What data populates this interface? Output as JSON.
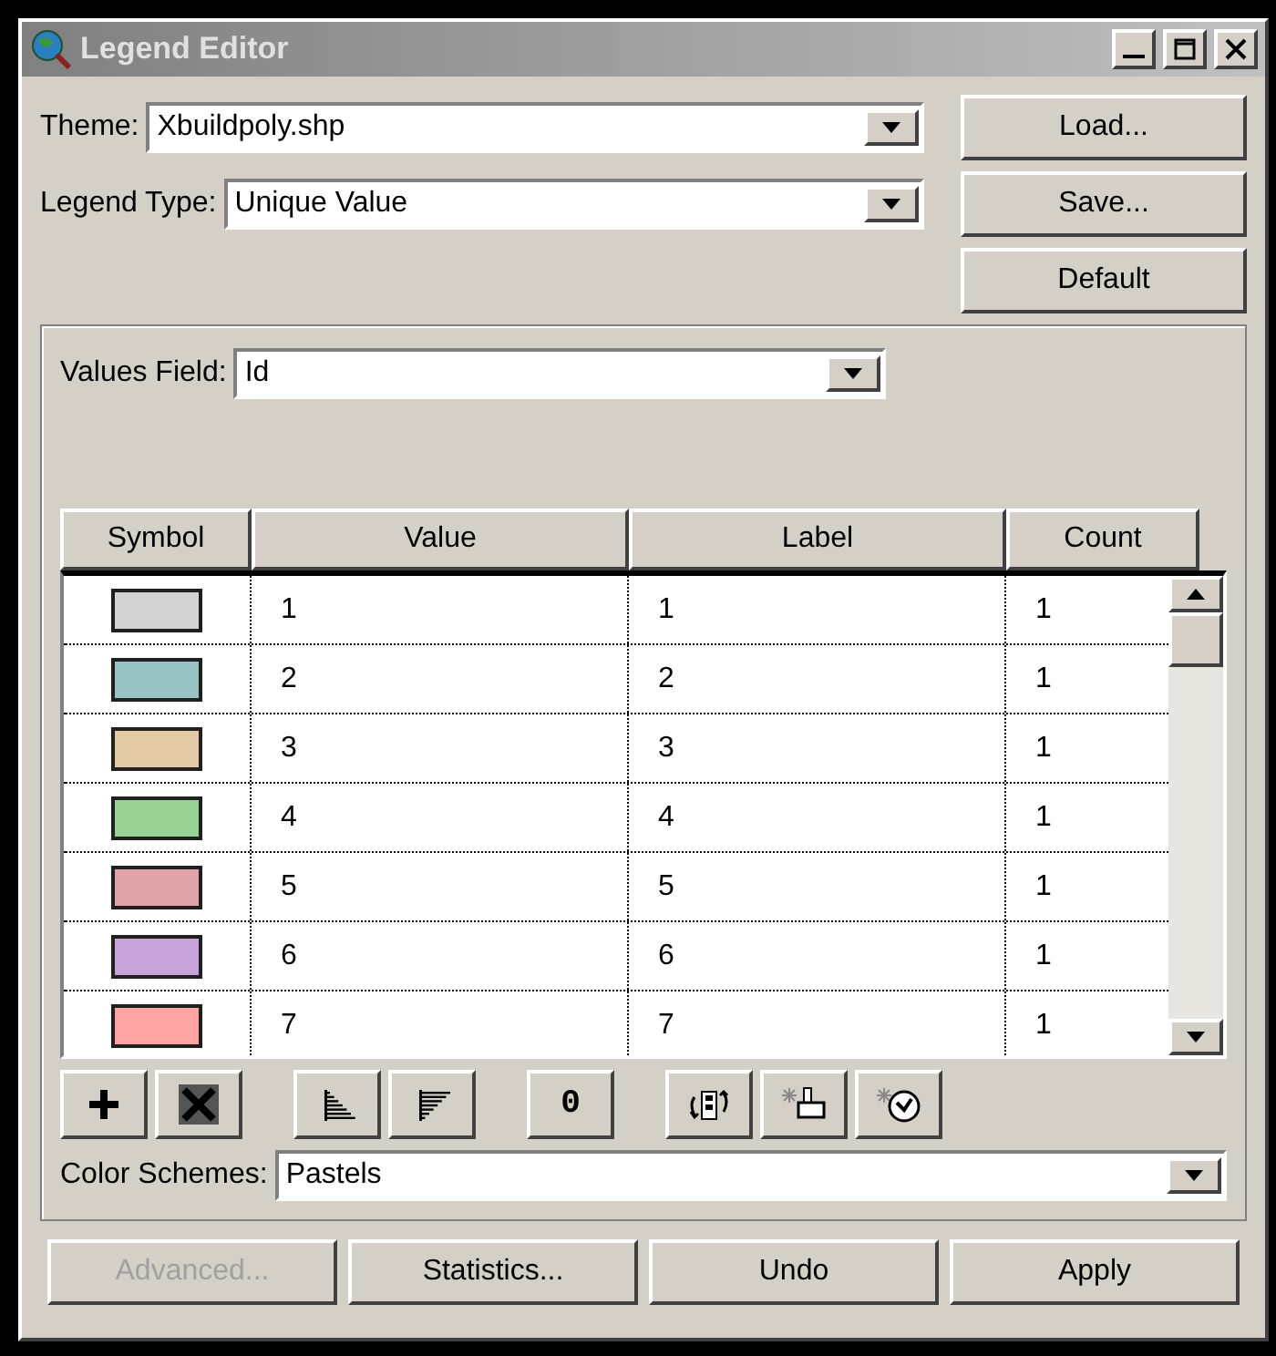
{
  "window": {
    "title": "Legend Editor"
  },
  "theme": {
    "label": "Theme:",
    "value": "Xbuildpoly.shp"
  },
  "legend_type": {
    "label": "Legend Type:",
    "value": "Unique Value"
  },
  "side_buttons": [
    "Load...",
    "Save...",
    "Default"
  ],
  "values_field": {
    "label": "Values Field:",
    "value": "Id"
  },
  "table": {
    "columns": [
      "Symbol",
      "Value",
      "Label",
      "Count"
    ],
    "rows": [
      {
        "color": "#d3d3d3",
        "value": "1",
        "label": "1",
        "count": "1"
      },
      {
        "color": "#99c2c4",
        "value": "2",
        "label": "2",
        "count": "1"
      },
      {
        "color": "#e3caa5",
        "value": "3",
        "label": "3",
        "count": "1"
      },
      {
        "color": "#99d394",
        "value": "4",
        "label": "4",
        "count": "1"
      },
      {
        "color": "#e0a3a8",
        "value": "5",
        "label": "5",
        "count": "1"
      },
      {
        "color": "#c6a3d8",
        "value": "6",
        "label": "6",
        "count": "1"
      },
      {
        "color": "#ffa3a3",
        "value": "7",
        "label": "7",
        "count": "1"
      }
    ]
  },
  "toolbar": [
    {
      "kind": "add"
    },
    {
      "kind": "delete"
    },
    {
      "kind": "sort-ascending"
    },
    {
      "kind": "sort-descending"
    },
    {
      "kind": "text",
      "text": "0"
    },
    {
      "kind": "reverse"
    },
    {
      "kind": "brush"
    },
    {
      "kind": "palette"
    }
  ],
  "color_schemes": {
    "label": "Color Schemes:",
    "value": "Pastels"
  },
  "bottom_buttons": [
    {
      "label": "Advanced...",
      "disabled": true
    },
    {
      "label": "Statistics...",
      "disabled": false
    },
    {
      "label": "Undo",
      "disabled": false
    },
    {
      "label": "Apply",
      "disabled": false
    }
  ]
}
